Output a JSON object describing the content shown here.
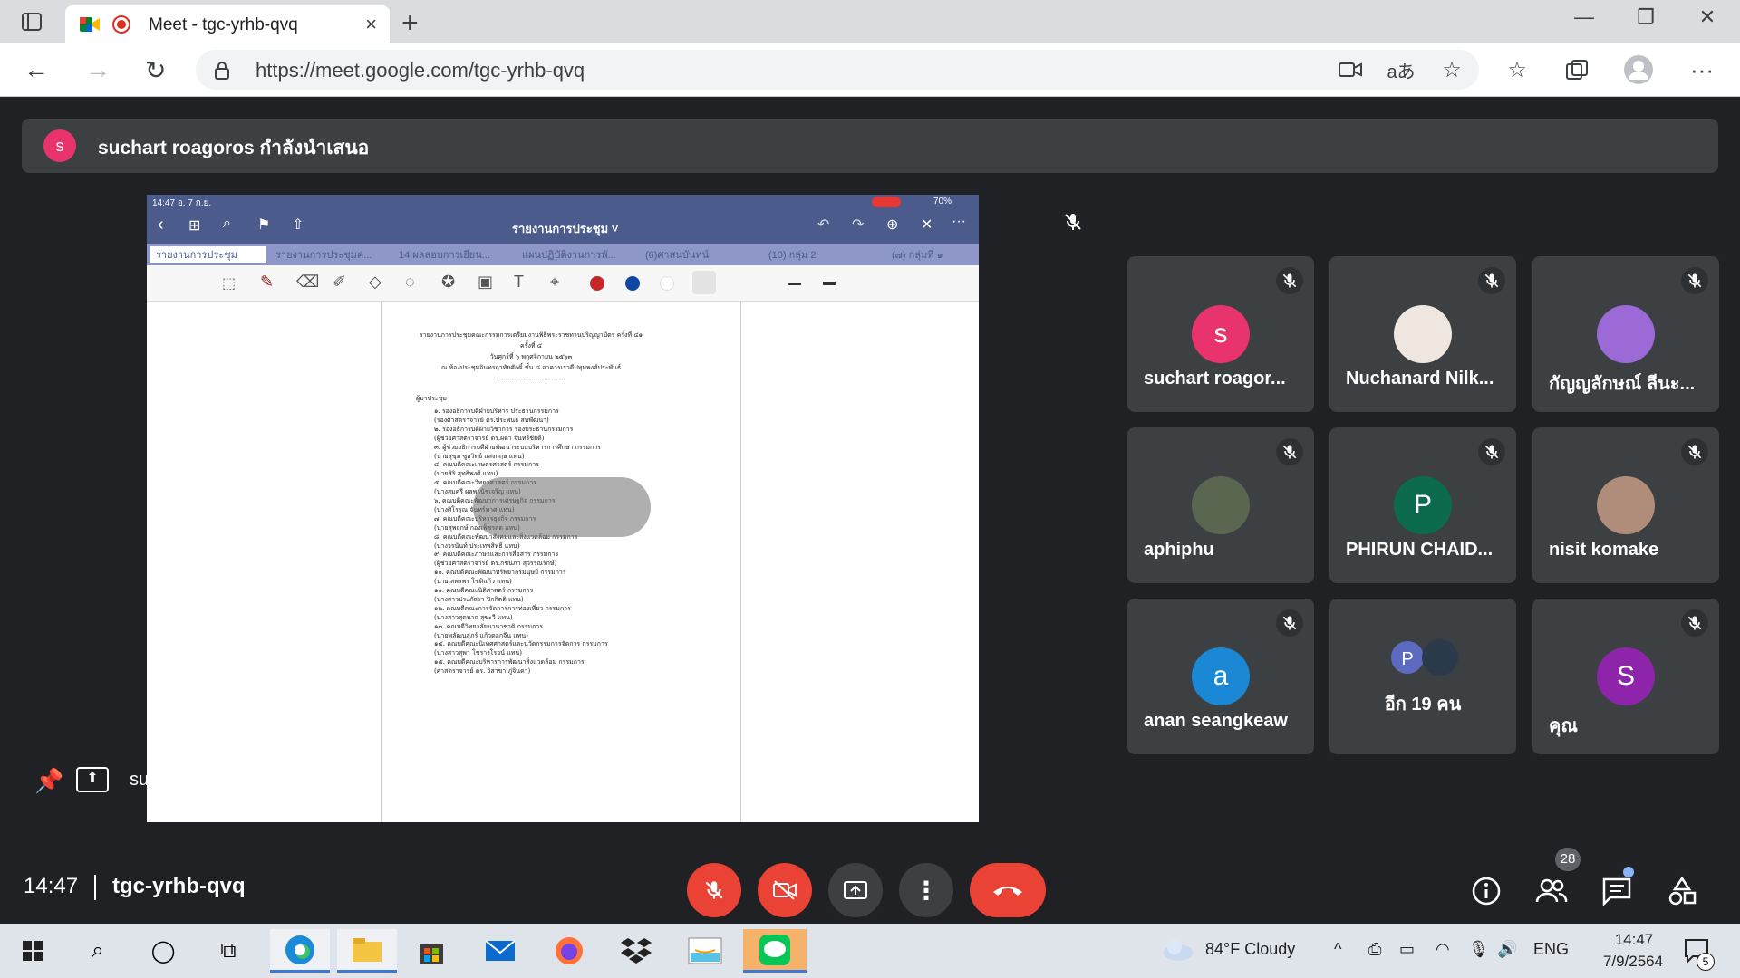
{
  "browser": {
    "tab_title": "Meet - tgc-yrhb-qvq",
    "url": "https://meet.google.com/tgc-yrhb-qvq",
    "new_tab": "+",
    "close_tab": "×"
  },
  "meet": {
    "presenting_avatar": "s",
    "presenting_text": "suchart roagoros กำลังนำเสนอ",
    "presenter_label": "suchart roagoros",
    "time": "14:47",
    "meeting_code": "tgc-yrhb-qvq",
    "participant_count": "28",
    "tiles": [
      {
        "name": "suchart roagor...",
        "initial": "s",
        "color": "#e8336d"
      },
      {
        "name": "Nuchanard Nilk...",
        "initial": "",
        "color": "#f0e6e0"
      },
      {
        "name": "กัญญลักษณ์ ลีนะ...",
        "initial": "",
        "color": "#9b6ad6"
      },
      {
        "name": "aphiphu",
        "initial": "",
        "color": "#5b6650"
      },
      {
        "name": "PHIRUN CHAID...",
        "initial": "P",
        "color": "#0c6b4e"
      },
      {
        "name": "nisit komake",
        "initial": "",
        "color": "#b08d7a"
      },
      {
        "name": "anan seangkeaw",
        "initial": "a",
        "color": "#1a88d4"
      },
      {
        "name": "อีก 19 คน",
        "initial": "P",
        "color": "#5c6bc0"
      },
      {
        "name": "คุณ",
        "initial": "S",
        "color": "#8e24aa"
      }
    ]
  },
  "ipad": {
    "status_time": "14:47  อ. 7 ก.ย.",
    "battery": "70%",
    "doc_title": "รายงานการประชุม ˅",
    "tabs": [
      "รายงานการประชุม",
      "รายงานการประชุมค...",
      "14 ผลลอบการเยียน...",
      "แผนปฏิบัติงานการพั...",
      "(6)ศาสนบันทน์",
      "(10) กลุ่ม 2",
      "(๗) กลุ่มที่ ๑"
    ],
    "doc_lines": [
      "รายงานการประชุมคณะกรรมการเตรียมงานพิธีพระราชทานปริญญาบัตร ครั้งที่ ๔๑",
      "ครั้งที่ ๔",
      "วันศุกร์ที่ ๖ พฤศจิกายน ๒๕๖๓",
      "ณ ห้องประชุมอินทรฤาทัยศักดิ์ ชั้น ๘ อาคารเรวดีปทุมพงศ์ประพันธ์",
      "--------------------------------",
      "ผู้มาประชุม",
      "๑. รองอธิการบดีฝ่ายบริหาร                                  ประธานกรรมการ",
      "   (รองศาสตราจารย์ ดร.ประพนธ์ สหพัฒนา)",
      "๒. รองอธิการบดีฝ่ายวิชาการ                                  รองประธานกรรมการ",
      "   (ผู้ช่วยศาสตราจารย์ ดร.ผดา จันทร์ชัยดี)",
      "๓. ผู้ช่วยอธิการบดีฝ่ายพัฒนาระบบบริหารการศึกษา           กรรมการ",
      "   (นายสุขุม ซูอวิทย์ แสงกฤษ แทน)",
      "๔. คณบดีคณะเกษตรศาสตร์                                    กรรมการ",
      "   (นายสิริ สุทธิพงศ์ แทน)",
      "๕. คณบดีคณะวิทยาศาสตร์                                    กรรมการ",
      "   (นางสมศรี ผลพานิชเจริญ แทน)",
      "๖. คณบดีคณะพัฒนาการเศรษฐกิจ                               กรรมการ",
      "   (นางศิโรรุณ จันทร์มาศ แทน)",
      "๗. คณบดีคณะบริหารธุรกิจ                                   กรรมการ",
      "   (นายสุพฤกษ์ กองเพ็ชรสุด แทน)",
      "๘. คณบดีคณะพัฒนาสังคมและสิ่งแวดล้อม                      กรรมการ",
      "   (นางวรนันท์ ประเทพสิทธิ์ แทน)",
      "๙. คณบดีคณะภาษาและการสื่อสาร                              กรรมการ",
      "   (ผู้ช่วยศาสตราจารย์ ดร.กชนภา สุวรรณรักษ์)",
      "๑๐. คณบดีคณะพัฒนาทรัพยากรมนุษย์                           กรรมการ",
      "   (นายเสพรพร โชติแก้ว แทน)",
      "๑๑. คณบดีคณะนิติศาสตร์                                    กรรมการ",
      "   (นางสาวประภัสรา ปิกกิตติ แทน)",
      "๑๒. คณบดีคณะการจัดการการท่องเที่ยว                        กรรมการ",
      "   (นางสาวสุดนาถ สุขะวี แทน)",
      "๑๓. คณบดีวิทยาลัยนานาชาติ                                  กรรมการ",
      "   (นายพลัฒนสุภร์ แก้วดอกจีน แทน)",
      "๑๔. คณบดีคณะนิเทศศาสตร์และนวัตกรรมการจัดการ               กรรมการ",
      "   (นางสาวสุพา โชรางโรจน์ แทน)",
      "๑๕. คณบดีคณะบริหารการพัฒนาสิ่งแวดล้อม                     กรรมการ",
      "   (ศาสตราจารย์ ดร. วิสาขา ภู่จินดา)"
    ]
  },
  "taskbar": {
    "weather": "84°F  Cloudy",
    "lang": "ENG",
    "time": "14:47",
    "date": "7/9/2564",
    "notif_count": "5"
  }
}
